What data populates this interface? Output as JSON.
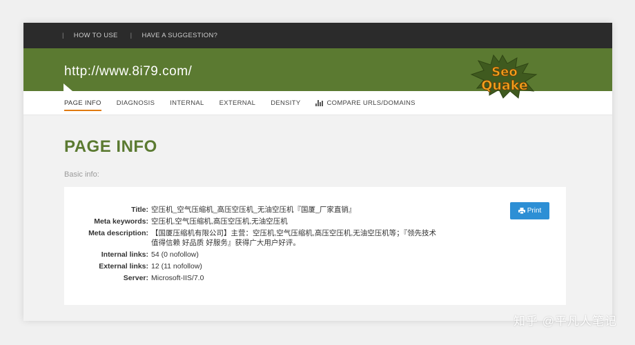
{
  "topbar": {
    "separator": "|",
    "how_to_use": "HOW TO USE",
    "suggestion": "HAVE A SUGGESTION?"
  },
  "header": {
    "url": "http://www.8i79.com/",
    "logo_text_top": "Seo",
    "logo_text_bottom": "Quake"
  },
  "tabs": [
    {
      "label": "PAGE INFO",
      "active": true
    },
    {
      "label": "DIAGNOSIS"
    },
    {
      "label": "INTERNAL"
    },
    {
      "label": "EXTERNAL"
    },
    {
      "label": "DENSITY"
    },
    {
      "label": "COMPARE URLS/DOMAINS"
    }
  ],
  "page": {
    "title": "PAGE INFO",
    "subtitle": "Basic info:"
  },
  "info": {
    "print_label": "Print",
    "rows": [
      {
        "label": "Title:",
        "value": "空压机_空气压缩机_高压空压机_无油空压机『国厦_厂家直销』"
      },
      {
        "label": "Meta keywords:",
        "value": "空压机,空气压缩机,高压空压机,无油空压机"
      },
      {
        "label": "Meta description:",
        "value": "【国厦压缩机有限公司】主营：空压机,空气压缩机,高压空压机,无油空压机等；『领先技术 值得信赖 好品质 好服务』获得广大用户好评。"
      },
      {
        "label": "Internal links:",
        "value": "54 (0 nofollow)"
      },
      {
        "label": "External links:",
        "value": "12 (11 nofollow)"
      },
      {
        "label": "Server:",
        "value": "Microsoft-IIS/7.0"
      }
    ]
  },
  "watermark": "知乎 @平凡人笔记",
  "colors": {
    "brand_green": "#5b7a31",
    "topbar": "#2b2b2b",
    "accent_orange": "#e07a10",
    "button_blue": "#2d8fd5"
  }
}
